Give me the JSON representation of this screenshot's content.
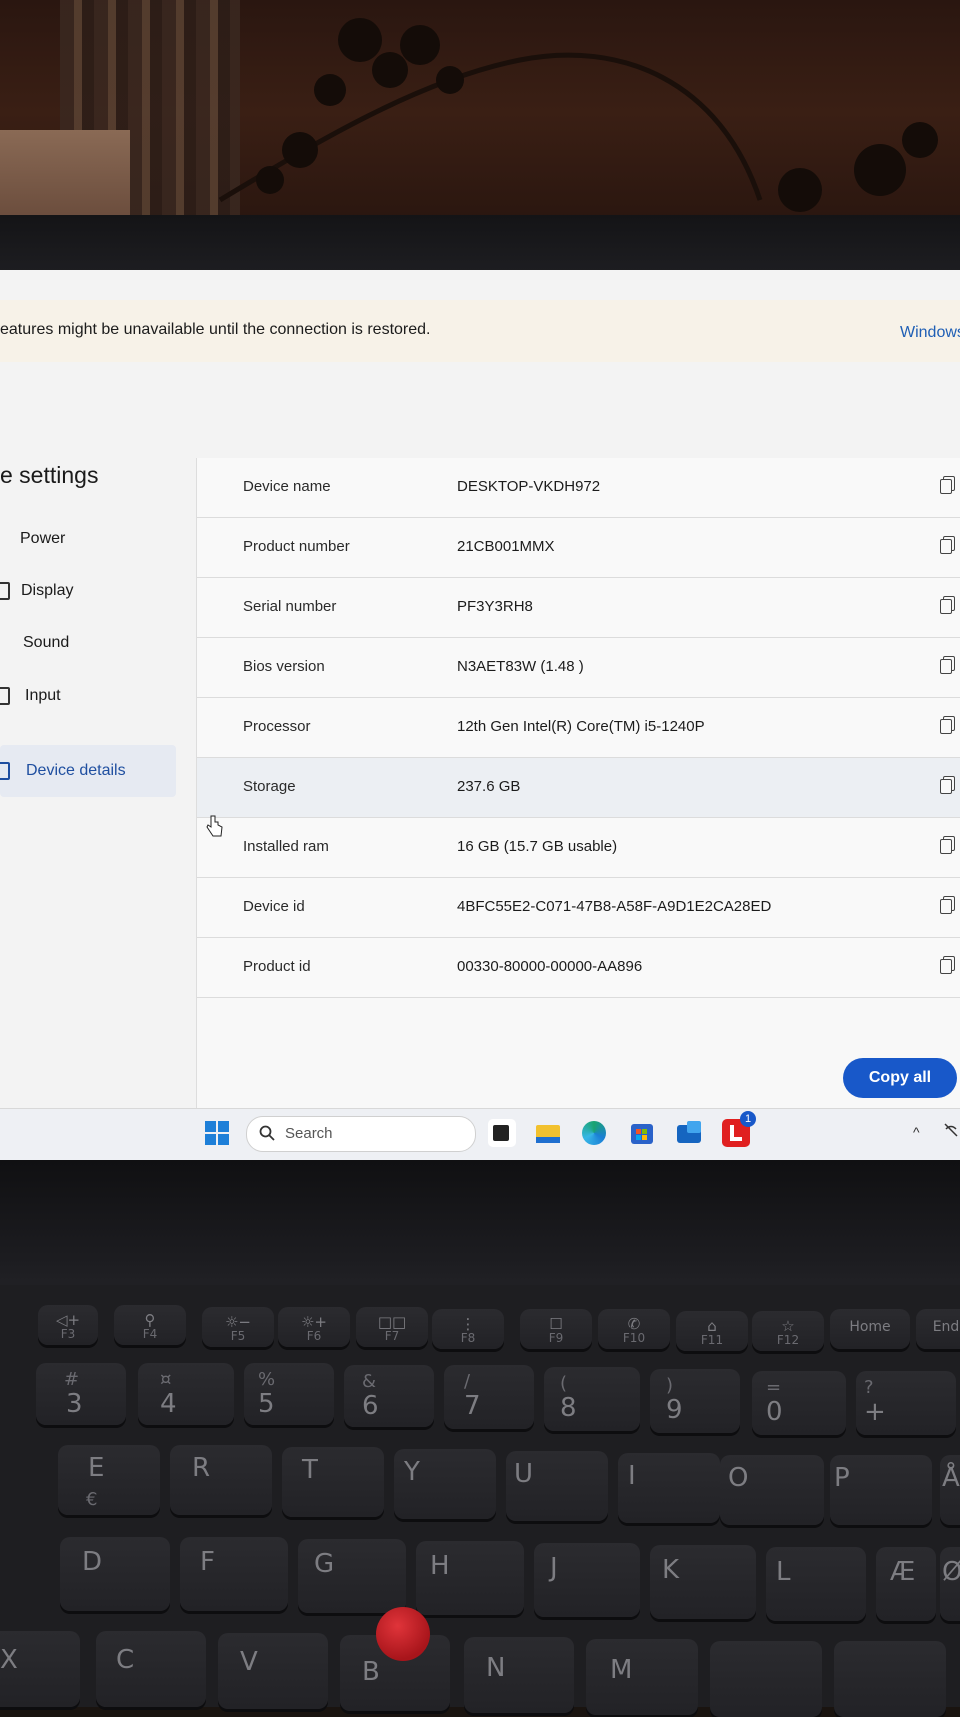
{
  "banner": {
    "message": "eatures might be unavailable until the connection is restored.",
    "link": "Windows"
  },
  "page": {
    "title": "e settings"
  },
  "sidebar": {
    "items": [
      {
        "label": "Power",
        "selected": false
      },
      {
        "label": "Display",
        "selected": false
      },
      {
        "label": "Sound",
        "selected": false
      },
      {
        "label": "Input",
        "selected": false
      },
      {
        "label": "Device details",
        "selected": true
      }
    ]
  },
  "details": {
    "rows": [
      {
        "label": "Device name",
        "value": "DESKTOP-VKDH972"
      },
      {
        "label": "Product number",
        "value": "21CB001MMX"
      },
      {
        "label": "Serial number",
        "value": "PF3Y3RH8"
      },
      {
        "label": "Bios version",
        "value": "N3AET83W (1.48 )"
      },
      {
        "label": "Processor",
        "value": "12th Gen Intel(R) Core(TM) i5-1240P"
      },
      {
        "label": "Storage",
        "value": "237.6 GB"
      },
      {
        "label": "Installed ram",
        "value": "16 GB (15.7 GB usable)"
      },
      {
        "label": "Device id",
        "value": "4BFC55E2-C071-47B8-A58F-A9D1E2CA28ED"
      },
      {
        "label": "Product id",
        "value": "00330-80000-00000-AA896"
      }
    ],
    "copy_all_label": "Copy all"
  },
  "taskbar": {
    "search_placeholder": "Search",
    "badge_count": "1",
    "apps": [
      "task-view-icon",
      "file-explorer-icon",
      "edge-icon",
      "store-icon",
      "outlook-icon",
      "lenovo-vantage-icon"
    ]
  },
  "keyboard": {
    "fkeys": [
      "F3",
      "F4",
      "F5",
      "F6",
      "F7",
      "F8",
      "F9",
      "F10",
      "F11",
      "F12",
      "Home",
      "End"
    ],
    "number_row": [
      "3",
      "4",
      "5",
      "6",
      "7",
      "8",
      "9",
      "0",
      "+"
    ],
    "number_row_shift": [
      "#",
      "¤",
      "%",
      "&",
      "/",
      "(",
      ")",
      "=",
      "?"
    ],
    "top_row": [
      "E",
      "R",
      "T",
      "Y",
      "U",
      "I",
      "O",
      "P",
      "Å"
    ],
    "home_row": [
      "D",
      "F",
      "G",
      "H",
      "J",
      "K",
      "L",
      "Æ",
      "Ø"
    ],
    "bottom_row": [
      "X",
      "C",
      "V",
      "B",
      "N",
      "M"
    ]
  },
  "colors": {
    "accent": "#1858c9",
    "selected_nav": "#e6eaf2",
    "trackpoint": "#c9252b"
  }
}
